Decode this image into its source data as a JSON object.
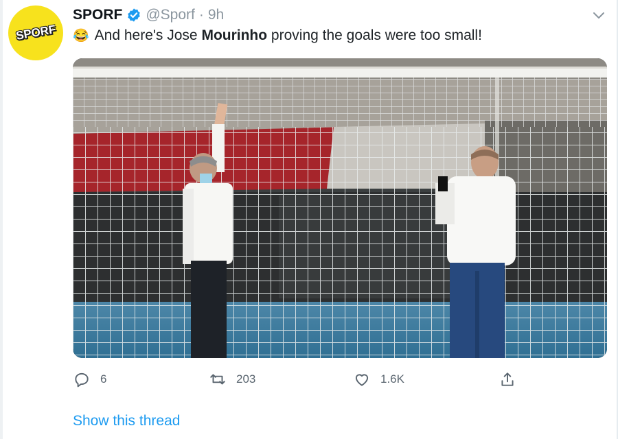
{
  "tweet": {
    "avatar_text": "SPORF",
    "display_name": "SPORF",
    "handle": "@Sporf",
    "separator": "·",
    "time": "9h",
    "emoji": "😂",
    "text_before": "And here's Jose ",
    "text_bold": "Mourinho",
    "text_after": " proving the goals were too small!",
    "accent_color": "#1d9bf0"
  },
  "actions": {
    "replies": "6",
    "retweets": "203",
    "likes": "1.6K"
  },
  "show_thread": "Show this thread",
  "icons": [
    "verified-badge-icon",
    "chevron-down-icon",
    "reply-icon",
    "retweet-icon",
    "like-icon",
    "share-icon"
  ]
}
